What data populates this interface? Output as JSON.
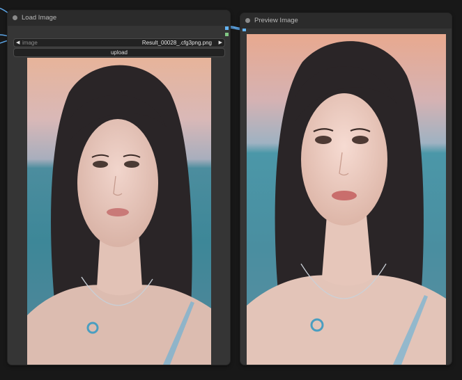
{
  "load_node": {
    "title": "Load Image",
    "combo_label": "image",
    "combo_value": "Result_00028_.cfg3png.png",
    "upload_label": "upload",
    "prev_arrow": "◀",
    "next_arrow": "▶"
  },
  "preview_node": {
    "title": "Preview Image"
  },
  "colors": {
    "canvas_bg": "#181818",
    "node_bg": "#353535",
    "header_bg": "#2b2b2b",
    "wire": "#5ea8ea",
    "image_output_slot": "#64b5f6",
    "mask_output_slot": "#81c784"
  },
  "icons": [
    "node-status-dot",
    "prev-arrow-icon",
    "next-arrow-icon"
  ]
}
